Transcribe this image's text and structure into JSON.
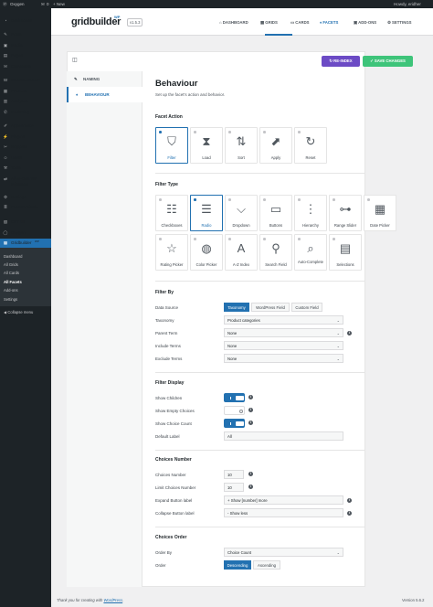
{
  "adminbar": {
    "wp_icon": "wordpress-icon",
    "site_name": "Oxygen",
    "comments_count": "0",
    "new_label": "+ New",
    "howdy": "Howdy, eridher"
  },
  "sidebar": {
    "items": [
      {
        "label": "Dashboard",
        "icon": "dashboard-icon"
      },
      {
        "label": "Posts",
        "icon": "pin-icon"
      },
      {
        "label": "Media",
        "icon": "media-icon"
      },
      {
        "label": "Pages",
        "icon": "page-icon"
      },
      {
        "label": "Comments",
        "icon": "comment-icon"
      },
      {
        "label": "WooCommerce",
        "icon": "woo-icon"
      },
      {
        "label": "Products",
        "icon": "box-icon"
      },
      {
        "label": "Analytics",
        "icon": "chart-icon"
      },
      {
        "label": "Marketing",
        "icon": "megaphone-icon"
      },
      {
        "label": "Appearance",
        "icon": "brush-icon"
      },
      {
        "label": "Plugins",
        "icon": "plug-icon"
      },
      {
        "label": "Snippets",
        "icon": "scissors-icon"
      },
      {
        "label": "Users",
        "icon": "user-icon"
      },
      {
        "label": "Tools",
        "icon": "wrench-icon"
      },
      {
        "label": "All-in-One WP Migration",
        "icon": "migration-icon"
      },
      {
        "label": "Settings",
        "icon": "settings-icon"
      },
      {
        "label": "Custom Fields",
        "icon": "fields-icon"
      },
      {
        "label": "CPT UI",
        "icon": "cpt-icon"
      },
      {
        "label": "Oxygen",
        "icon": "oxygen-icon"
      },
      {
        "label": "Gridbuilder",
        "badge": "WP",
        "icon": "gridbuilder-icon"
      }
    ],
    "submenu": [
      "Dashboard",
      "All Grids",
      "All Cards",
      "All Facets",
      "Add-ons",
      "Settings"
    ],
    "collapse_label": "Collapse menu"
  },
  "topnav": {
    "logo": "gridbuilder",
    "logo_badge": "WP",
    "version": "v1.5.3",
    "items": [
      "DASHBOARD",
      "GRIDS",
      "CARDS",
      "FACETS",
      "ADD-ONS",
      "SETTINGS"
    ]
  },
  "actions": {
    "reindex": "RE-INDEX",
    "save": "SAVE CHANGES",
    "reindex_color": "#6c4bc5",
    "save_color": "#3ec47a",
    "accent": "#2271b1"
  },
  "tabs": {
    "naming": "NAMING",
    "behaviour": "BEHAVIOUR"
  },
  "main": {
    "title": "Behaviour",
    "description": "Set up the facet's action and behavior.",
    "facet_action": {
      "heading": "Facet Action",
      "options": [
        {
          "label": "Filter",
          "icon": "filter-icon",
          "glyph": "⛉"
        },
        {
          "label": "Load",
          "icon": "hourglass-icon",
          "glyph": "⧗"
        },
        {
          "label": "Sort",
          "icon": "sort-icon",
          "glyph": "⇅"
        },
        {
          "label": "Apply",
          "icon": "apply-icon",
          "glyph": "⬈"
        },
        {
          "label": "Reset",
          "icon": "reset-icon",
          "glyph": "↻"
        }
      ]
    },
    "filter_type": {
      "heading": "Filter Type",
      "options": [
        {
          "label": "Checkboxes",
          "icon": "checkbox-icon",
          "glyph": "☷"
        },
        {
          "label": "Radio",
          "icon": "radio-icon",
          "glyph": "☰"
        },
        {
          "label": "Dropdown",
          "icon": "dropdown-icon",
          "glyph": "⌵"
        },
        {
          "label": "Buttons",
          "icon": "buttons-icon",
          "glyph": "▭"
        },
        {
          "label": "Hierarchy",
          "icon": "hierarchy-icon",
          "glyph": "⋮"
        },
        {
          "label": "Range Slider",
          "icon": "slider-icon",
          "glyph": "⊶"
        },
        {
          "label": "Date Picker",
          "icon": "calendar-icon",
          "glyph": "▦"
        },
        {
          "label": "Rating Picker",
          "icon": "star-icon",
          "glyph": "☆"
        },
        {
          "label": "Color Picker",
          "icon": "palette-icon",
          "glyph": "◍"
        },
        {
          "label": "A-Z Index",
          "icon": "az-icon",
          "glyph": "A"
        },
        {
          "label": "Search Field",
          "icon": "search-icon",
          "glyph": "⚲"
        },
        {
          "label": "Auto-Complete",
          "icon": "autocomplete-icon",
          "glyph": "⌕"
        },
        {
          "label": "Selections",
          "icon": "selections-icon",
          "glyph": "▤"
        }
      ]
    },
    "filter_by": {
      "heading": "Filter By",
      "data_source_label": "Data Source",
      "data_source_options": [
        "Taxonomy",
        "WordPress Field",
        "Custom Field"
      ],
      "taxonomy_label": "Taxonomy",
      "taxonomy_value": "Product categories",
      "parent_term_label": "Parent Term",
      "parent_term_value": "None",
      "include_terms_label": "Include Terms",
      "include_terms_value": "None",
      "exclude_terms_label": "Exclude Terms",
      "exclude_terms_value": "None"
    },
    "filter_display": {
      "heading": "Filter Display",
      "show_children_label": "Show Children",
      "show_children": true,
      "show_empty_label": "Show Empty Choices",
      "show_empty": false,
      "show_count_label": "Show Choice Count",
      "show_count": true,
      "default_label_label": "Default Label",
      "default_label_value": "All"
    },
    "choices_number": {
      "heading": "Choices Number",
      "choices_label": "Choices Number",
      "choices_value": "10",
      "limit_label": "Limit Choices Number",
      "limit_value": "10",
      "expand_label": "Expand Button label",
      "expand_value": "+ Show [number] more",
      "collapse_label": "Collapse Button label",
      "collapse_value": "- Show less"
    },
    "choices_order": {
      "heading": "Choices Order",
      "order_by_label": "Order By",
      "order_by_value": "Choice Count",
      "order_label": "Order",
      "order_options": [
        "Descending",
        "Ascending"
      ]
    }
  },
  "footer": {
    "text": "Thank you for creating with ",
    "link": "WordPress",
    "version": "Version 5.6.2"
  }
}
